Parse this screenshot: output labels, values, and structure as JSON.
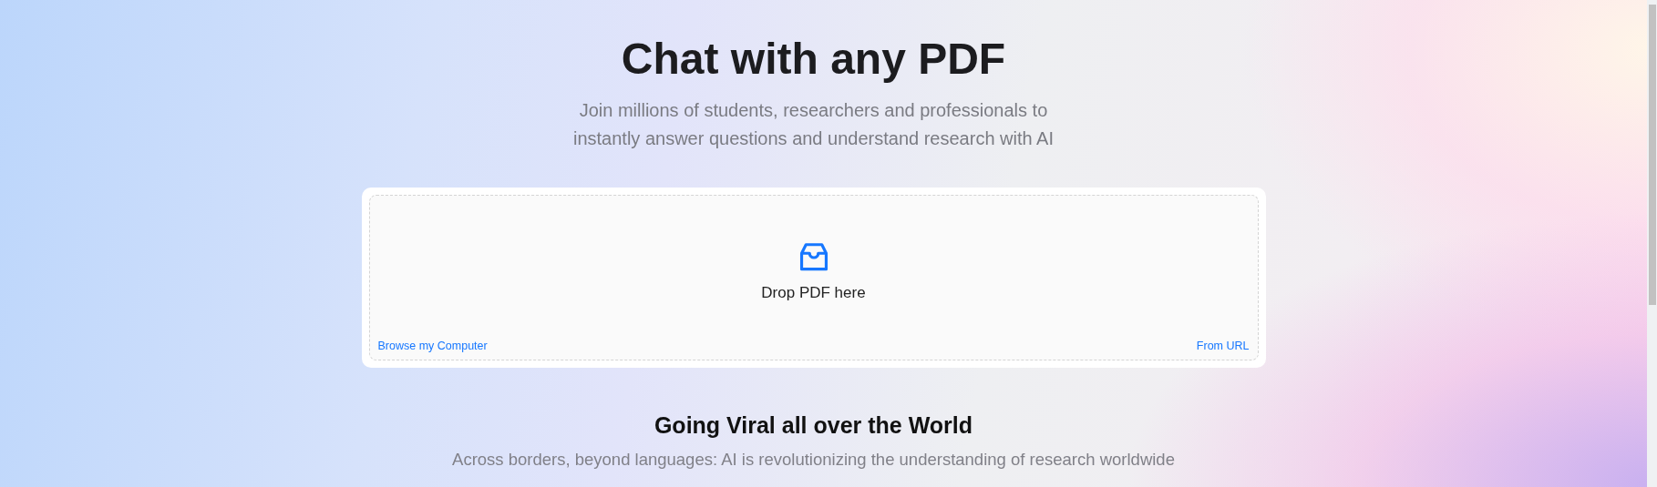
{
  "hero": {
    "title": "Chat with any PDF",
    "subtitle_lines": [
      "Join millions of students, researchers and professionals to",
      "instantly answer questions and understand research with AI"
    ]
  },
  "upload": {
    "prompt": "Drop PDF here",
    "browse_link": "Browse my Computer",
    "url_link": "From URL"
  },
  "section": {
    "title": "Going Viral all over the World",
    "subtitle": "Across borders, beyond languages: AI is revolutionizing the understanding of research worldwide"
  }
}
